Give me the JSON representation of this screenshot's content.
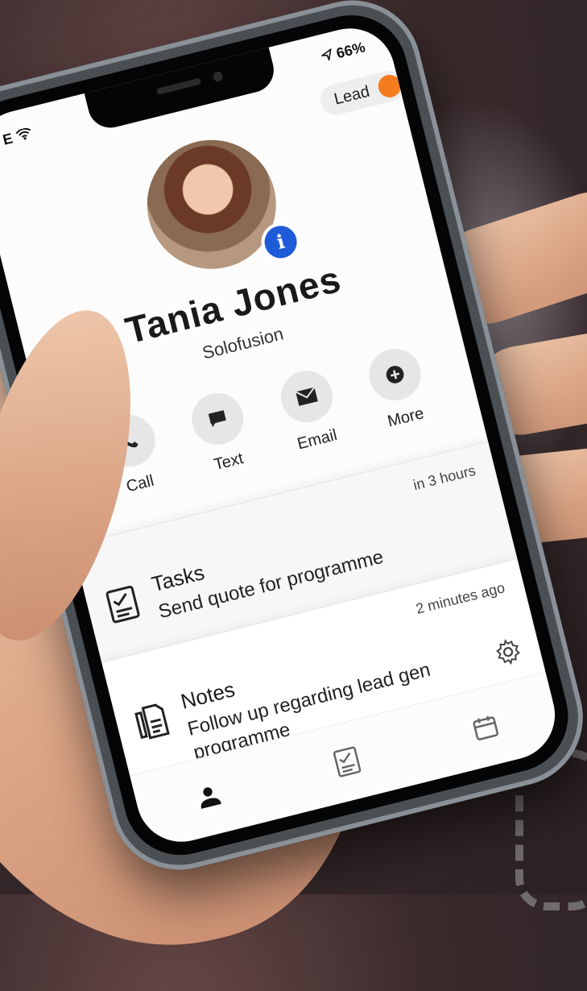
{
  "status": {
    "left": "E",
    "battery": "66%"
  },
  "lead_badge": "Lead",
  "contact": {
    "name": "Tania Jones",
    "company": "Solofusion"
  },
  "actions": [
    {
      "label": "Call",
      "icon": "phone-icon"
    },
    {
      "label": "Text",
      "icon": "message-icon"
    },
    {
      "label": "Email",
      "icon": "mail-icon"
    },
    {
      "label": "More",
      "icon": "plus-circle-icon"
    }
  ],
  "tasks": {
    "time": "in 3 hours",
    "title": "Tasks",
    "text": "Send quote for programme",
    "icon": "task-icon"
  },
  "notes": {
    "time": "2 minutes ago",
    "title": "Notes",
    "text": "Follow up regarding lead gen programme",
    "icon": "note-icon"
  },
  "tabbar": [
    "person-icon",
    "task-icon",
    "calendar-icon"
  ],
  "colors": {
    "accent_orange": "#f57c1f",
    "info_blue": "#1e5bd8"
  }
}
